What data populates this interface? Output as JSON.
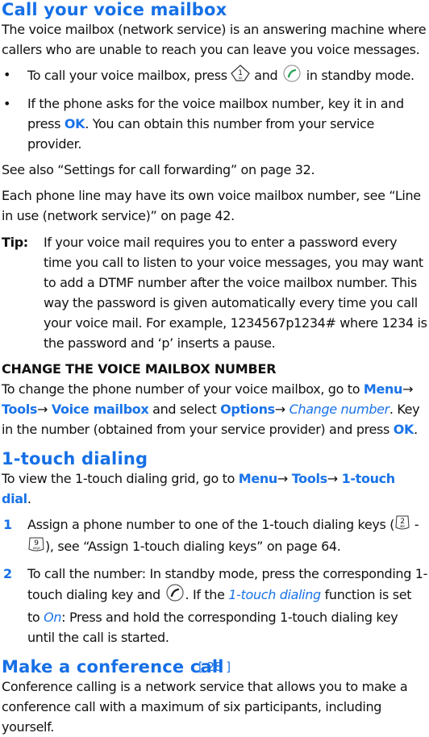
{
  "section1": {
    "title": "Call your voice mailbox",
    "intro": "The voice mailbox (network service) is an answering machine where callers who are unable to reach you can leave you voice messages.",
    "bullet1": {
      "pre": "To call your voice mailbox, press",
      "mid": "and",
      "post": "in standby mode.",
      "icons": [
        "key-1-voicemail-icon",
        "call-key-icon"
      ]
    },
    "bullet2": {
      "pre": "If the phone asks for the voice mailbox number, key it in and press",
      "ok": "OK",
      "post": ". You can obtain this number from your service provider."
    },
    "see_also": "See also “Settings for call forwarding” on page 32.",
    "line_use": "Each phone line may have its own voice mailbox number, see “Line in use (network service)” on page 42.",
    "tip_label": "Tip:",
    "tip_text": "If your voice mail requires you to enter a password every time you call to listen to your voice messages, you may want to add a DTMF number after the voice mailbox number. This way the password is given automatically every time you call your voice mail. For example, 1234567p1234# where 1234 is the password and ‘p’ inserts a pause."
  },
  "change": {
    "heading": "CHANGE THE VOICE MAILBOX NUMBER",
    "t1": "To change the phone number of your voice mailbox, go to",
    "menu": "Menu",
    "arrow": "→",
    "tools": "Tools",
    "voice_mailbox": "Voice mailbox",
    "t2": "and select",
    "options": "Options",
    "change_number": "Change number",
    "t3": ". Key in the number (obtained from your service provider) and press",
    "ok": "OK",
    "t4": "."
  },
  "section2": {
    "title": "1-touch dialing",
    "intro_pre": "To view the 1-touch dialing grid, go to",
    "menu": "Menu",
    "tools": "Tools",
    "dial": "1-touch dial",
    "arrow": "→",
    "steps": [
      {
        "n": "1",
        "pre": "Assign a phone number to one of the 1-touch dialing keys (",
        "dash": "-",
        "post": "), see “Assign 1-touch dialing keys” on page 64."
      },
      {
        "n": "2",
        "pre": "To call the number: In standby mode, press the corresponding 1-touch dialing key and",
        "mid": ". If the",
        "func": "1-touch dialing",
        "mid2": "function is set to",
        "on": "On",
        "post": ": Press and hold the corresponding 1-touch dialing key until the call is started."
      }
    ],
    "key2": {
      "digit": "2",
      "letters": "abc"
    },
    "key9": {
      "digit": "9",
      "letters": "wxyz"
    }
  },
  "section3": {
    "title": "Make a conference call",
    "intro": "Conference calling is a network service that allows you to make a conference call with a maximum of six participants, including yourself."
  },
  "footer": {
    "page": "[ 28 ]"
  },
  "colors": {
    "accent": "#1670e6",
    "text": "#111111",
    "call_green": "#2ca55a"
  }
}
